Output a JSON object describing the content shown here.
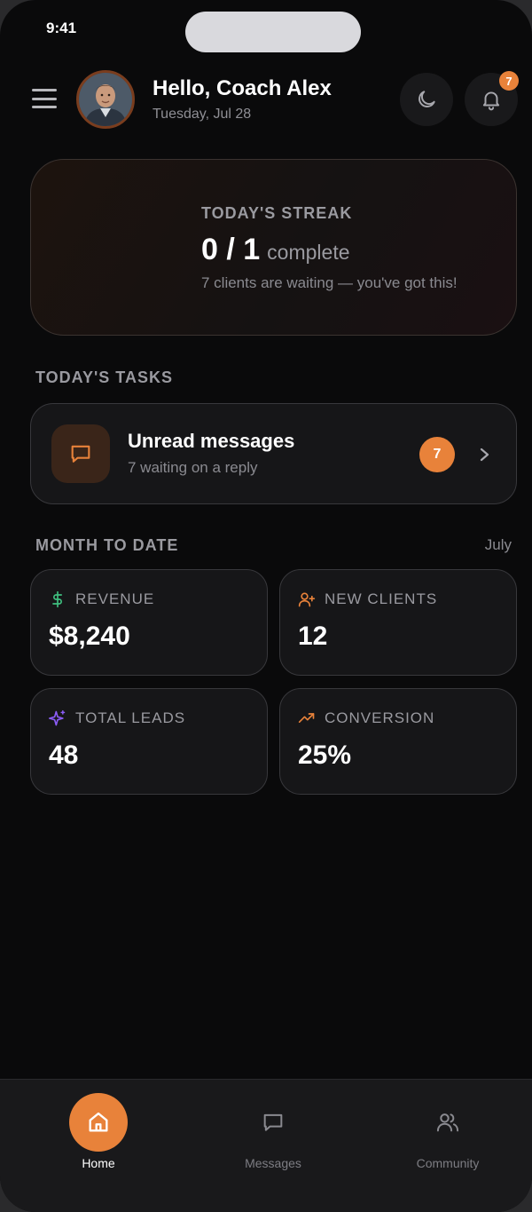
{
  "status_bar": {
    "time": "9:41"
  },
  "header": {
    "greeting": "Hello, Coach Alex",
    "date": "Tuesday, Jul 28",
    "notification_count": "7"
  },
  "streak": {
    "label": "TODAY'S STREAK",
    "count": "0 / 1",
    "suffix": "complete",
    "subtitle": "7 clients are waiting — you've got this!",
    "progress": 0
  },
  "tasks": {
    "section_title": "TODAY'S TASKS",
    "items": [
      {
        "title": "Unread messages",
        "subtitle": "7 waiting on a reply",
        "badge": "7"
      }
    ]
  },
  "month_to_date": {
    "section_title": "MONTH TO DATE",
    "month": "July",
    "stats": [
      {
        "label": "REVENUE",
        "value": "$8,240",
        "icon": "dollar-icon",
        "color": "#3fbf7f"
      },
      {
        "label": "NEW CLIENTS",
        "value": "12",
        "icon": "user-plus-icon",
        "color": "#e8823a"
      },
      {
        "label": "TOTAL LEADS",
        "value": "48",
        "icon": "sparkle-icon",
        "color": "#8b5cf6"
      },
      {
        "label": "CONVERSION",
        "value": "25%",
        "icon": "trending-up-icon",
        "color": "#e8823a"
      }
    ]
  },
  "bottom_nav": {
    "items": [
      {
        "label": "Home",
        "icon": "home-icon",
        "active": true
      },
      {
        "label": "Messages",
        "icon": "message-icon",
        "active": false
      },
      {
        "label": "Community",
        "icon": "users-icon",
        "active": false
      }
    ]
  },
  "colors": {
    "accent": "#e8823a",
    "background": "#0a0a0b",
    "card": "#161618",
    "revenue_green": "#3fbf7f",
    "leads_purple": "#8b5cf6"
  }
}
